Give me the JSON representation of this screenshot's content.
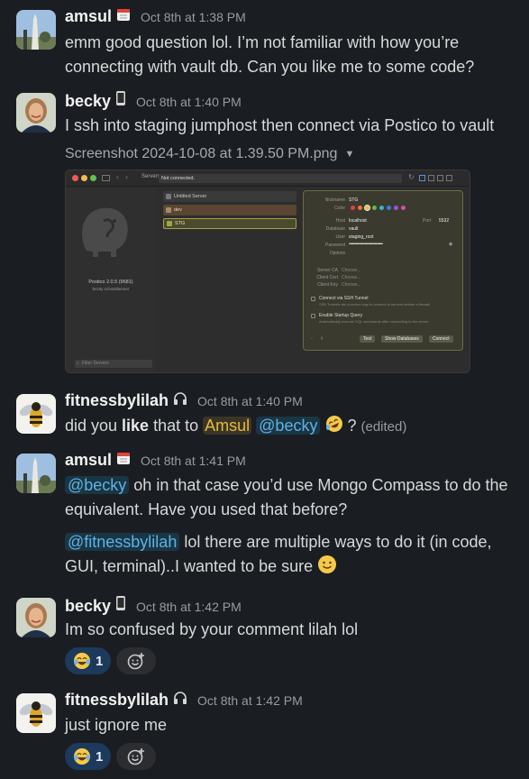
{
  "messages": [
    {
      "author": "amsul",
      "status_icon": "calendar-icon",
      "time": "Oct 8th at 1:38 PM",
      "text": "emm good question lol. I’m not familiar with how you’re connecting with vault db. Can you like me to some code?"
    },
    {
      "author": "becky",
      "status_icon": "phone-icon",
      "time": "Oct 8th at 1:40 PM",
      "text": "I ssh into staging jumphost then connect via Postico to vault",
      "attachment": {
        "filename": "Screenshot 2024-10-08 at 1.39.50 PM.png",
        "caret": "▼",
        "postico": {
          "sidebar_tab": "Servers",
          "status": "Not connected.",
          "app_version": "Postico 2.0.5 (9681)",
          "license": "becky schmittlienner",
          "servers": [
            "Untitled Server",
            "dev",
            "STG"
          ],
          "filter_placeholder": "Filter Servers",
          "nickname_label": "Nickname",
          "nickname": "STG",
          "color_label": "Color",
          "host_label": "Host",
          "host": "localhost",
          "port_label": "Port",
          "port": "5532",
          "database_label": "Database",
          "database": "vault",
          "user_label": "User",
          "user": "staging_root",
          "password_label": "Password",
          "password": "••••••••••••••••••••••••••••••",
          "options_label": "Options",
          "server_ca_label": "Server CA",
          "client_cert_label": "Client Cert",
          "client_key_label": "Client Key",
          "choose": "Choose...",
          "ssh_label": "Connect via SSH Tunnel",
          "ssh_desc": "SSH Tunnels are a secure way to connect to servers behind a firewall",
          "startup_label": "Enable Startup Query",
          "startup_desc": "Automatically execute SQL commands after connecting to the server",
          "test_btn": "Test",
          "show_db_btn": "Show Databases",
          "connect_btn": "Connect",
          "palette": [
            "#e0433a",
            "#e5783a",
            "#e8c23e",
            "#69b94a",
            "#3bb2c9",
            "#3a7be0",
            "#9a52d6",
            "#d64fa3"
          ]
        }
      }
    },
    {
      "author": "fitnessbylilah",
      "status_icon": "headphones-icon",
      "time": "Oct 8th at 1:40 PM",
      "text_parts": {
        "a": "did you ",
        "b": "like",
        "c": " that to ",
        "mention1": "Amsul",
        "mention2": "@becky",
        "d": " ? ",
        "edited": "(edited)"
      },
      "emoji": "rofl-emoji"
    },
    {
      "author": "amsul",
      "status_icon": "calendar-icon",
      "time": "Oct 8th at 1:41 PM",
      "p1_mention": "@becky",
      "p1_text": " oh in that case you’d use Mongo Compass to do the equivalent. Have you used that before?",
      "p2_mention": "@fitnessbylilah",
      "p2_text": " lol there are multiple ways to do it (in code, GUI, terminal)..I wanted to be sure ",
      "emoji": "slightly-smiling-emoji"
    },
    {
      "author": "becky",
      "status_icon": "phone-icon",
      "time": "Oct 8th at 1:42 PM",
      "text": "Im so confused by your comment lilah lol",
      "reaction": {
        "emoji": "joy-emoji",
        "count": "1"
      }
    },
    {
      "author": "fitnessbylilah",
      "status_icon": "headphones-icon",
      "time": "Oct 8th at 1:42 PM",
      "text": "just ignore me",
      "reaction": {
        "emoji": "joy-emoji",
        "count": "1"
      }
    }
  ],
  "colors": {
    "background": "#1a1d21",
    "mention": "#5eb2e6",
    "mention_self": "#e8b93e",
    "reaction_active": "#1d3a5c"
  }
}
